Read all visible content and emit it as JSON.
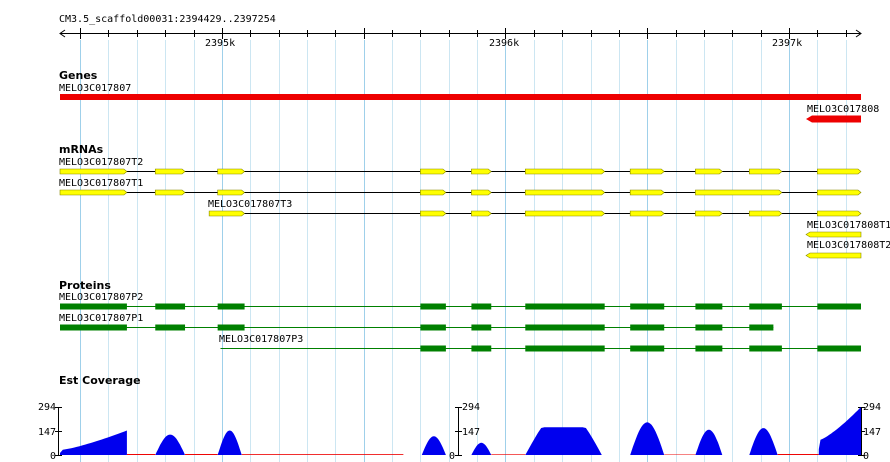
{
  "region": {
    "label": "CM3.5_scaffold00031:2394429..2397254",
    "start": 2394429,
    "end": 2397254
  },
  "ruler": {
    "ticks": [
      {
        "pos": 2395000,
        "label": "2395k"
      },
      {
        "pos": 2396000,
        "label": "2396k"
      },
      {
        "pos": 2397000,
        "label": "2397k"
      }
    ]
  },
  "colors": {
    "gene": "#ee0000",
    "mrna_exon": "#ffff00",
    "mrna_border": "#888800",
    "protein": "#008000",
    "coverage": "#0000ee",
    "coverage_low": "#ee0000",
    "grid": "#cce6f2",
    "grid_major": "#9fd0ea"
  },
  "tracks": {
    "genes": {
      "title": "Genes",
      "features": [
        {
          "name": "MELO3C017807",
          "start": 2394429,
          "end": 2397254,
          "strand": "+"
        },
        {
          "name": "MELO3C017808",
          "start": 2397060,
          "end": 2397254,
          "strand": "-"
        }
      ]
    },
    "mrnas": {
      "title": "mRNAs",
      "features": [
        {
          "name": "MELO3C017807T2",
          "start": 2394429,
          "end": 2397254,
          "exons": [
            [
              2394429,
              2394665
            ],
            [
              2394765,
              2394870
            ],
            [
              2394985,
              2395080
            ],
            [
              2395700,
              2395790
            ],
            [
              2395880,
              2395950
            ],
            [
              2396070,
              2396350
            ],
            [
              2396440,
              2396560
            ],
            [
              2396670,
              2396765
            ],
            [
              2396860,
              2396975
            ],
            [
              2397100,
              2397254
            ]
          ]
        },
        {
          "name": "MELO3C017807T1",
          "start": 2394429,
          "end": 2397254,
          "exons": [
            [
              2394429,
              2394665
            ],
            [
              2394765,
              2394870
            ],
            [
              2394985,
              2395080
            ],
            [
              2395700,
              2395790
            ],
            [
              2395880,
              2395950
            ],
            [
              2396070,
              2396350
            ],
            [
              2396440,
              2396560
            ],
            [
              2396670,
              2396975
            ],
            [
              2397100,
              2397254
            ]
          ]
        },
        {
          "name": "MELO3C017807T3",
          "start": 2394955,
          "end": 2397254,
          "exons": [
            [
              2394955,
              2395080
            ],
            [
              2395700,
              2395790
            ],
            [
              2395880,
              2395950
            ],
            [
              2396070,
              2396350
            ],
            [
              2396440,
              2396560
            ],
            [
              2396670,
              2396765
            ],
            [
              2396860,
              2396975
            ],
            [
              2397100,
              2397254
            ]
          ]
        },
        {
          "name": "MELO3C017808T1",
          "start": 2397060,
          "end": 2397254,
          "exons": [
            [
              2397060,
              2397254
            ]
          ],
          "strand": "-"
        },
        {
          "name": "MELO3C017808T2",
          "start": 2397060,
          "end": 2397254,
          "exons": [
            [
              2397060,
              2397254
            ]
          ],
          "strand": "-"
        }
      ]
    },
    "proteins": {
      "title": "Proteins",
      "features": [
        {
          "name": "MELO3C017807P2",
          "start": 2394429,
          "end": 2397254,
          "exons": [
            [
              2394429,
              2394665
            ],
            [
              2394765,
              2394870
            ],
            [
              2394985,
              2395080
            ],
            [
              2395700,
              2395790
            ],
            [
              2395880,
              2395950
            ],
            [
              2396070,
              2396350
            ],
            [
              2396440,
              2396560
            ],
            [
              2396670,
              2396765
            ],
            [
              2396860,
              2396975
            ],
            [
              2397100,
              2397254
            ]
          ]
        },
        {
          "name": "MELO3C017807P1",
          "start": 2394429,
          "end": 2396945,
          "exons": [
            [
              2394429,
              2394665
            ],
            [
              2394765,
              2394870
            ],
            [
              2394985,
              2395080
            ],
            [
              2395700,
              2395790
            ],
            [
              2395880,
              2395950
            ],
            [
              2396070,
              2396350
            ],
            [
              2396440,
              2396560
            ],
            [
              2396670,
              2396765
            ],
            [
              2396860,
              2396945
            ]
          ]
        },
        {
          "name": "MELO3C017807P3",
          "start": 2394995,
          "end": 2397254,
          "exons": [
            [
              2395700,
              2395790
            ],
            [
              2395880,
              2395950
            ],
            [
              2396070,
              2396350
            ],
            [
              2396440,
              2396560
            ],
            [
              2396670,
              2396765
            ],
            [
              2396860,
              2396975
            ],
            [
              2397100,
              2397254
            ]
          ]
        }
      ]
    },
    "coverage": {
      "title": "Est Coverage",
      "max": 294,
      "axis_labels": [
        "294",
        "147",
        "0"
      ],
      "peaks": [
        {
          "from": 2394429,
          "to": 2394665,
          "shape": "ramp",
          "lo": 30,
          "hi": 150
        },
        {
          "from": 2394765,
          "to": 2394870,
          "shape": "hump",
          "hi": 125
        },
        {
          "from": 2394985,
          "to": 2395070,
          "shape": "hump",
          "hi": 150
        },
        {
          "from": 2395705,
          "to": 2395790,
          "shape": "hump",
          "hi": 115
        },
        {
          "from": 2395880,
          "to": 2395950,
          "shape": "hump",
          "hi": 75
        },
        {
          "from": 2396070,
          "to": 2396340,
          "shape": "plateau",
          "hi": 170
        },
        {
          "from": 2396440,
          "to": 2396560,
          "shape": "hump",
          "hi": 200
        },
        {
          "from": 2396670,
          "to": 2396765,
          "shape": "hump",
          "hi": 155
        },
        {
          "from": 2396860,
          "to": 2396960,
          "shape": "hump",
          "hi": 165
        },
        {
          "from": 2397105,
          "to": 2397254,
          "shape": "ramp",
          "lo": 90,
          "hi": 294
        }
      ],
      "low": [
        [
          2394665,
          2394765,
          6
        ],
        [
          2394870,
          2394985,
          6
        ],
        [
          2395070,
          2395640,
          5
        ],
        [
          2395950,
          2396070,
          4
        ],
        [
          2396560,
          2396670,
          3
        ],
        [
          2396960,
          2397105,
          6
        ]
      ]
    }
  }
}
